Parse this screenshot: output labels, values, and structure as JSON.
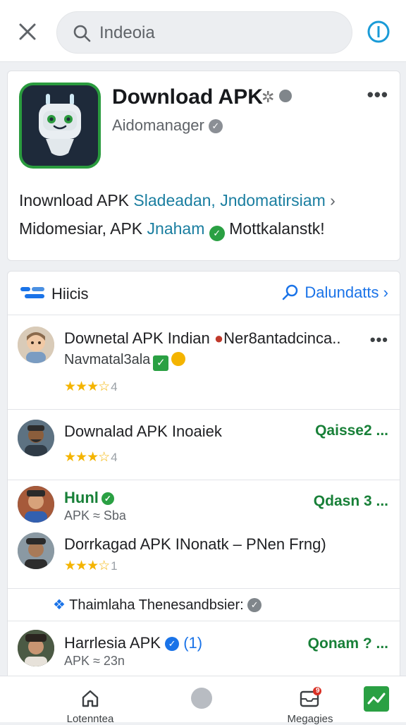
{
  "search": {
    "value": "Indeoia",
    "placeholder": "Search"
  },
  "app": {
    "title": "Download APK",
    "developer": "Aidomanager",
    "desc_line1_a": "Inownload APK ",
    "desc_line1_b": "Sladeadan, ",
    "desc_line1_c": "Jndomatirsiam",
    "desc_line2_a": "Midomesiar, APK ",
    "desc_line2_b": "Jnaham",
    "desc_line2_c": " Mottkalanstk!",
    "more": "•••"
  },
  "list": {
    "header_title": "Hiicis",
    "header_link": "Dalundatts",
    "rows": [
      {
        "title": "Downetal APK Indian",
        "title_extra": "Ner8antadcinca..",
        "sub": "Navmatal3ala",
        "rating": "★★★",
        "rating_half": "☆",
        "rating_val": "4",
        "action": "•••"
      },
      {
        "title": "Downalad APK Inoaiek",
        "rating": "★★★",
        "rating_half": "☆",
        "rating_val": "4",
        "action": "Qaisse2 ..."
      },
      {
        "title": "Hunl",
        "sub": "APK ≈ Sba",
        "action": "Qdasn 3 ..."
      },
      {
        "title": "Dorrkagad APK INonatk – PNen Frng)",
        "rating": "★★★",
        "rating_half": "☆",
        "rating_val": "1"
      },
      {
        "title": "Thaimlaha Thenesandbsier:"
      },
      {
        "title": "Harrlesia APK",
        "title_extra": "(1)",
        "sub": "APK ≈ 23n",
        "action": "Qonam ? ..."
      }
    ]
  },
  "nav": {
    "left_label": "Lotenntea",
    "right_label": "Megagies",
    "badge_count": "9"
  },
  "colors": {
    "accent": "#1a73e8",
    "green": "#188038",
    "star": "#f4b400"
  }
}
